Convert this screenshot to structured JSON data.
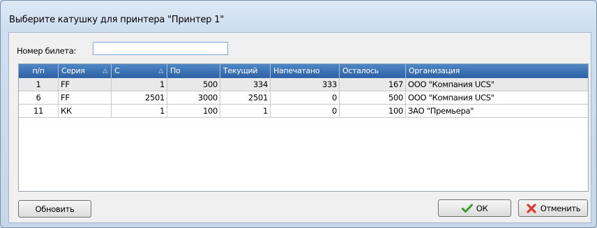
{
  "dialog": {
    "title": "Выберите катушку для принтера \"Принтер 1\""
  },
  "ticket": {
    "label": "Номер билета:",
    "value": ""
  },
  "table": {
    "columns": [
      {
        "label": "п/п"
      },
      {
        "label": "Серия",
        "sort": "△"
      },
      {
        "label": "С",
        "sort": "△"
      },
      {
        "label": "По"
      },
      {
        "label": "Текущий"
      },
      {
        "label": "Напечатано"
      },
      {
        "label": "Осталось"
      },
      {
        "label": "Организация"
      }
    ],
    "rows": [
      [
        "1",
        "FF",
        "1",
        "500",
        "334",
        "333",
        "167",
        "ООО \"Компания UCS\""
      ],
      [
        "6",
        "FF",
        "2501",
        "3000",
        "2501",
        "0",
        "500",
        "ООО \"Компания UCS\""
      ],
      [
        "11",
        "КК",
        "1",
        "100",
        "1",
        "0",
        "100",
        "ЗАО \"Премьера\""
      ]
    ]
  },
  "buttons": {
    "refresh": "Обновить",
    "ok": "ОК",
    "cancel": "Отменить"
  },
  "icons": {
    "ok": "checkmark-icon",
    "cancel": "red-x-icon"
  }
}
